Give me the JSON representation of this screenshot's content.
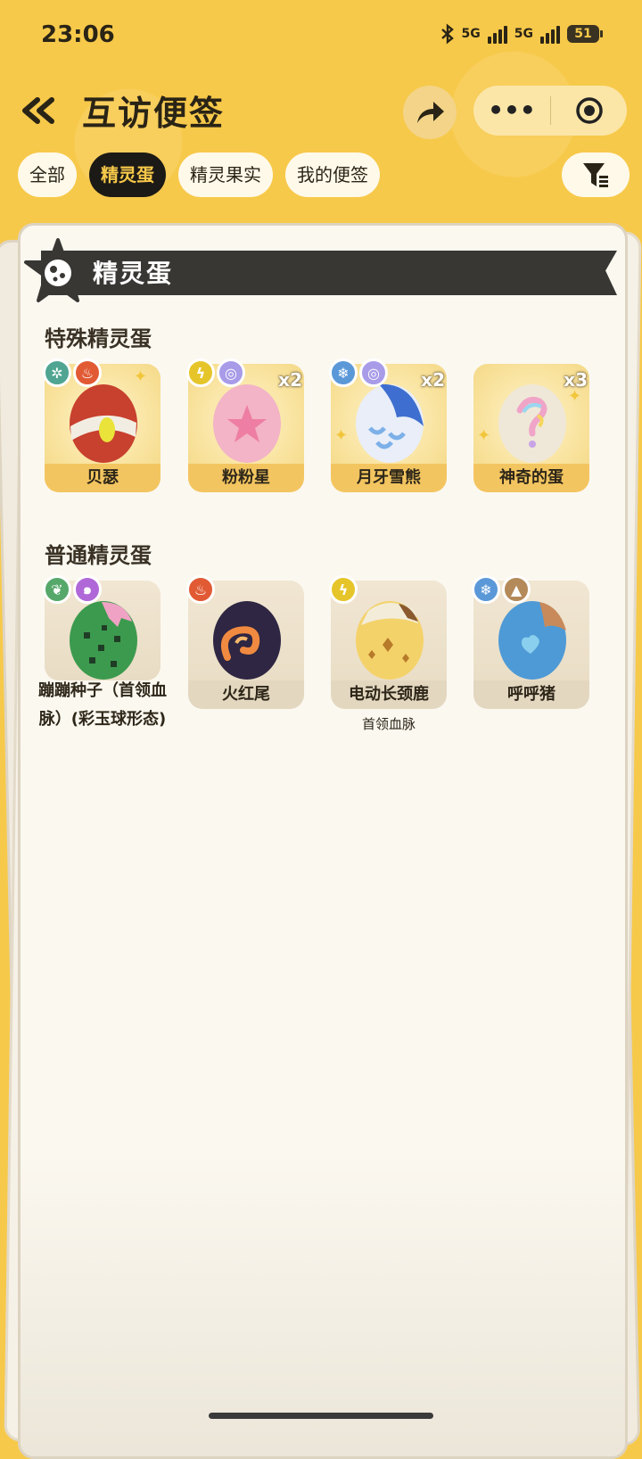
{
  "status": {
    "time": "23:06",
    "net1": "5G",
    "net2": "5G",
    "battery": "51"
  },
  "header": {
    "title": "互访便签",
    "more": "•••"
  },
  "tabs": [
    {
      "label": "全部",
      "active": false
    },
    {
      "label": "精灵蛋",
      "active": true
    },
    {
      "label": "精灵果实",
      "active": false
    },
    {
      "label": "我的便签",
      "active": false
    }
  ],
  "banner": {
    "title": "精灵蛋"
  },
  "sections": {
    "special": {
      "title": "特殊精灵蛋",
      "items": [
        {
          "name": "贝瑟",
          "count": "",
          "badges": [
            "gear-icon",
            "fire-icon"
          ]
        },
        {
          "name": "粉粉星",
          "count": "x2",
          "badges": [
            "lightning-icon",
            "spiral-icon"
          ]
        },
        {
          "name": "月牙雪熊",
          "count": "x2",
          "badges": [
            "snowflake-icon",
            "spiral-icon"
          ]
        },
        {
          "name": "神奇的蛋",
          "count": "x3",
          "badges": []
        }
      ]
    },
    "normal": {
      "title": "普通精灵蛋",
      "items": [
        {
          "name": "蹦蹦种子（首领血脉）(彩玉球形态)",
          "sub": "",
          "badges": [
            "leaf-icon",
            "swirl-icon"
          ]
        },
        {
          "name": "火红尾",
          "sub": "",
          "badges": [
            "fire-icon"
          ]
        },
        {
          "name": "电动长颈鹿",
          "sub": "首领血脉",
          "badges": [
            "lightning-icon"
          ]
        },
        {
          "name": "呼呼猪",
          "sub": "",
          "badges": [
            "snowflake-icon",
            "mountain-icon"
          ]
        }
      ]
    }
  },
  "colors": {
    "background": "#f7c94a",
    "active_tab": "#1c1a16",
    "banner": "#393734"
  }
}
